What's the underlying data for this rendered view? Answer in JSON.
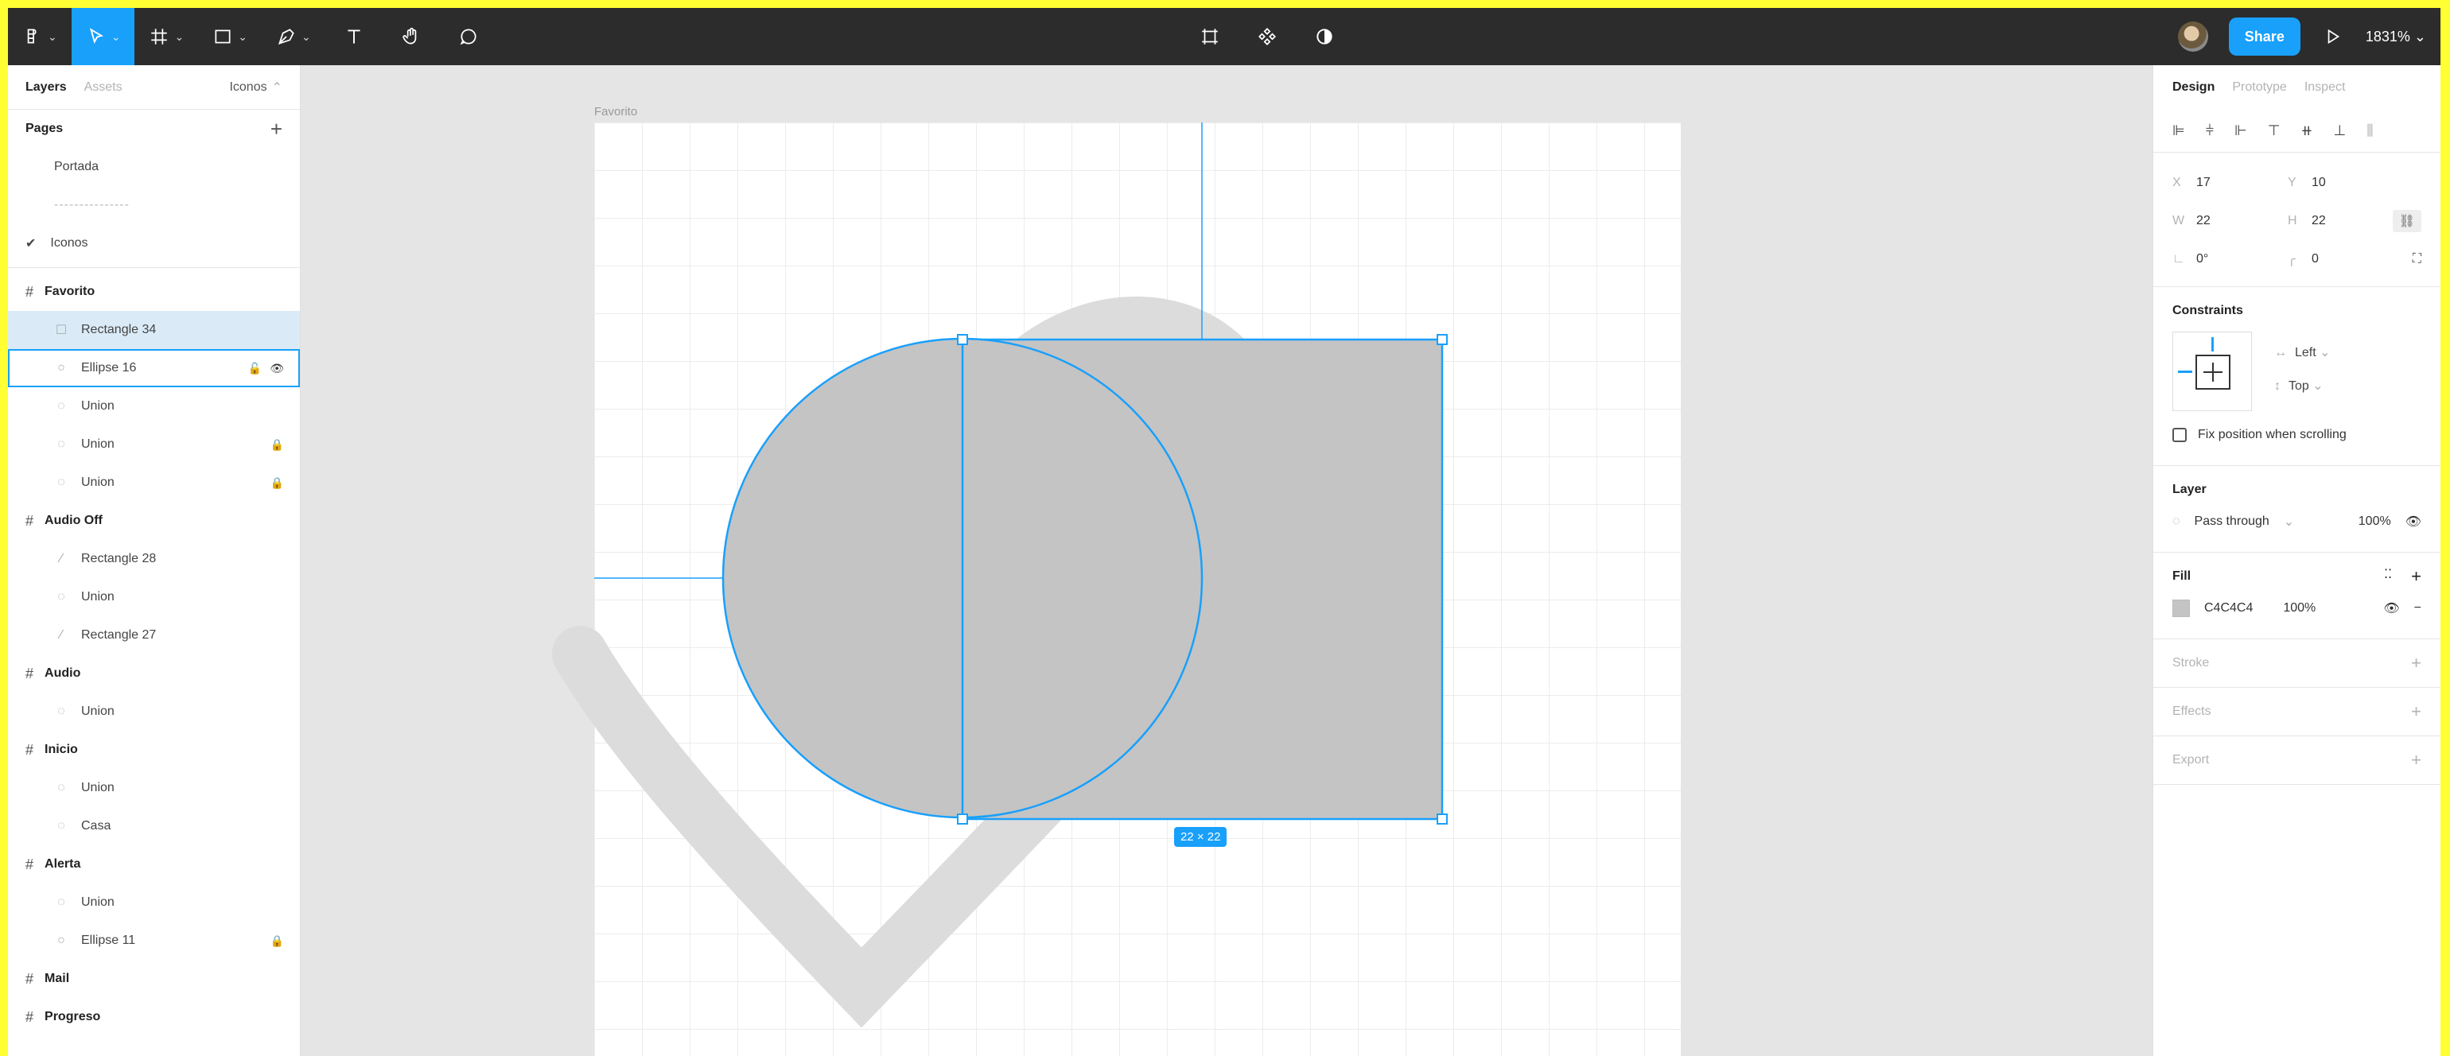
{
  "toolbar": {
    "share_label": "Share",
    "zoom_label": "1831%"
  },
  "left_panel": {
    "tabs": {
      "layers": "Layers",
      "assets": "Assets",
      "page_selector": "Iconos"
    },
    "pages_header": "Pages",
    "pages": [
      {
        "label": "Portada"
      },
      {
        "label": "---------------"
      },
      {
        "label": "Iconos",
        "current": true
      }
    ],
    "layers": [
      {
        "type": "frame",
        "label": "Favorito"
      },
      {
        "type": "layer",
        "icon": "rectangle",
        "label": "Rectangle 34",
        "selected": true
      },
      {
        "type": "layer",
        "icon": "ellipse",
        "label": "Ellipse 16",
        "hovered": true
      },
      {
        "type": "layer",
        "icon": "union",
        "label": "Union"
      },
      {
        "type": "layer",
        "icon": "union",
        "label": "Union",
        "locked": true
      },
      {
        "type": "layer",
        "icon": "union",
        "label": "Union",
        "locked": true
      },
      {
        "type": "frame",
        "label": "Audio Off"
      },
      {
        "type": "layer",
        "icon": "vector",
        "label": "Rectangle 28"
      },
      {
        "type": "layer",
        "icon": "union",
        "label": "Union"
      },
      {
        "type": "layer",
        "icon": "vector",
        "label": "Rectangle 27"
      },
      {
        "type": "frame",
        "label": "Audio"
      },
      {
        "type": "layer",
        "icon": "union",
        "label": "Union"
      },
      {
        "type": "frame",
        "label": "Inicio"
      },
      {
        "type": "layer",
        "icon": "union",
        "label": "Union"
      },
      {
        "type": "layer",
        "icon": "union",
        "label": "Casa"
      },
      {
        "type": "frame",
        "label": "Alerta"
      },
      {
        "type": "layer",
        "icon": "union",
        "label": "Union"
      },
      {
        "type": "layer",
        "icon": "ellipse",
        "label": "Ellipse 11",
        "locked": true
      },
      {
        "type": "frame",
        "label": "Mail"
      },
      {
        "type": "frame",
        "label": "Progreso"
      }
    ]
  },
  "canvas": {
    "frame_label": "Favorito",
    "dimension_badge": "22 × 22",
    "fill_color": "#c4c4c4",
    "selection_color": "#18a0fb"
  },
  "right_panel": {
    "tabs": {
      "design": "Design",
      "prototype": "Prototype",
      "inspect": "Inspect"
    },
    "props": {
      "x_label": "X",
      "x": "17",
      "y_label": "Y",
      "y": "10",
      "w_label": "W",
      "w": "22",
      "h_label": "H",
      "h": "22",
      "rotation": "0°",
      "radius": "0"
    },
    "constraints": {
      "title": "Constraints",
      "horizontal": "Left",
      "vertical": "Top",
      "fix_position": "Fix position when scrolling"
    },
    "layer": {
      "title": "Layer",
      "blend": "Pass through",
      "opacity": "100%"
    },
    "fill": {
      "title": "Fill",
      "hex": "C4C4C4",
      "opacity": "100%"
    },
    "stroke_title": "Stroke",
    "effects_title": "Effects",
    "export_title": "Export"
  }
}
